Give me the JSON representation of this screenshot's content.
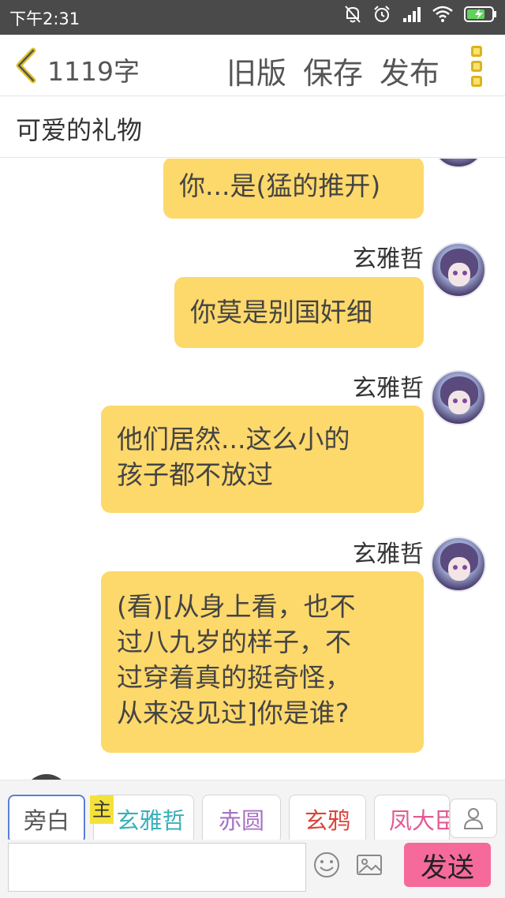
{
  "status_bar": {
    "time": "下午2:31",
    "icons": [
      "bell-off-icon",
      "alarm-icon",
      "signal-icon",
      "wifi-icon",
      "battery-charging-icon"
    ]
  },
  "header": {
    "word_count": "1119字",
    "old_version": "旧版",
    "save": "保存",
    "publish": "发布",
    "accent_color": "#ffe26b"
  },
  "story": {
    "title": "可爱的礼物"
  },
  "messages": [
    {
      "speaker": "",
      "text": "你...是(猛的推开)"
    },
    {
      "speaker": "玄雅哲",
      "text": "你莫是别国奸细"
    },
    {
      "speaker": "玄雅哲",
      "lines": [
        "他们居然...这么小的",
        "孩子都不放过"
      ]
    },
    {
      "speaker": "玄雅哲",
      "lines": [
        "(看)[从身上看，也不",
        "过八九岁的样子，不",
        "过穿着真的挺奇怪，",
        "从来没见过]你是谁?"
      ]
    }
  ],
  "roles": {
    "items": [
      {
        "label": "旁白",
        "color": "#555555"
      },
      {
        "label": "玄雅哲",
        "color": "#3ab0b8"
      },
      {
        "label": "赤圆",
        "color": "#a673c4"
      },
      {
        "label": "玄鸦",
        "color": "#d9453c"
      },
      {
        "label": "凤大臣",
        "color": "#e35a92"
      }
    ],
    "main_tag": "主"
  },
  "input": {
    "placeholder": "",
    "send": "发送"
  },
  "colors": {
    "bubble": "#fdd86b",
    "send_button": "#f56a9b",
    "active_role_border": "#5b7fd6"
  }
}
